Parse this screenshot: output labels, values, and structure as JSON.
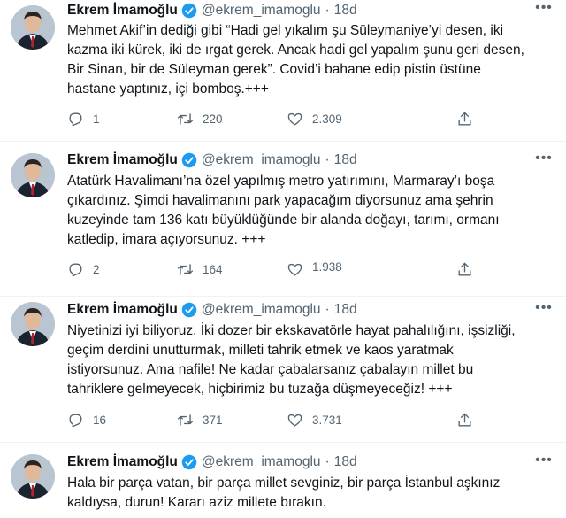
{
  "author": {
    "name": "Ekrem İmamoğlu",
    "handle": "@ekrem_imamoglu",
    "separator": "·",
    "time": "18d"
  },
  "icons": {
    "verified": "verified-badge-icon",
    "more": "more-dots-icon",
    "reply": "reply-icon",
    "retweet": "retweet-icon",
    "like": "heart-icon",
    "share": "share-icon"
  },
  "colors": {
    "verified": "#1d9bf0",
    "secondary_text": "#536471"
  },
  "tweets": [
    {
      "lines": [
        "Mehmet Akif’in dediği gibi “Hadi gel yıkalım şu Süleymaniye’yi desen, iki",
        "kazma iki kürek, iki de ırgat gerek. Ancak hadi gel yapalım şunu geri desen,",
        "Bir Sinan, bir de Süleyman gerek”. Covid’i bahane edip pistin üstüne",
        "hastane yaptınız, içi bomboş.+++"
      ],
      "replies": "1",
      "retweets": "220",
      "likes": "2.309"
    },
    {
      "lines": [
        "Atatürk Havalimanı’na özel yapılmış metro yatırımını, Marmaray’ı boşa",
        "çıkardınız. Şimdi havalimanını park yapacağım diyorsunuz ama şehrin",
        "kuzeyinde tam 136 katı büyüklüğünde bir alanda doğayı, tarımı, ormanı",
        "katledip, imara açıyorsunuz. +++"
      ],
      "replies": "2",
      "retweets": "164",
      "likes": "1.938"
    },
    {
      "lines": [
        "Niyetinizi iyi biliyoruz. İki dozer bir ekskavatörle hayat pahalılığını, işsizliği,",
        "geçim derdini unutturmak, milleti tahrik etmek ve kaos yaratmak",
        "istiyorsunuz. Ama nafile! Ne kadar çabalarsanız çabalayın millet bu",
        "tahriklere gelmeyecek, hiçbirimiz bu tuzağa düşmeyeceğiz! +++"
      ],
      "replies": "16",
      "retweets": "371",
      "likes": "3.731"
    },
    {
      "lines": [
        "Hala bir parça vatan, bir parça millet sevginiz, bir parça İstanbul aşkınız",
        "kaldıysa, durun! Kararı aziz millete bırakın."
      ]
    }
  ]
}
